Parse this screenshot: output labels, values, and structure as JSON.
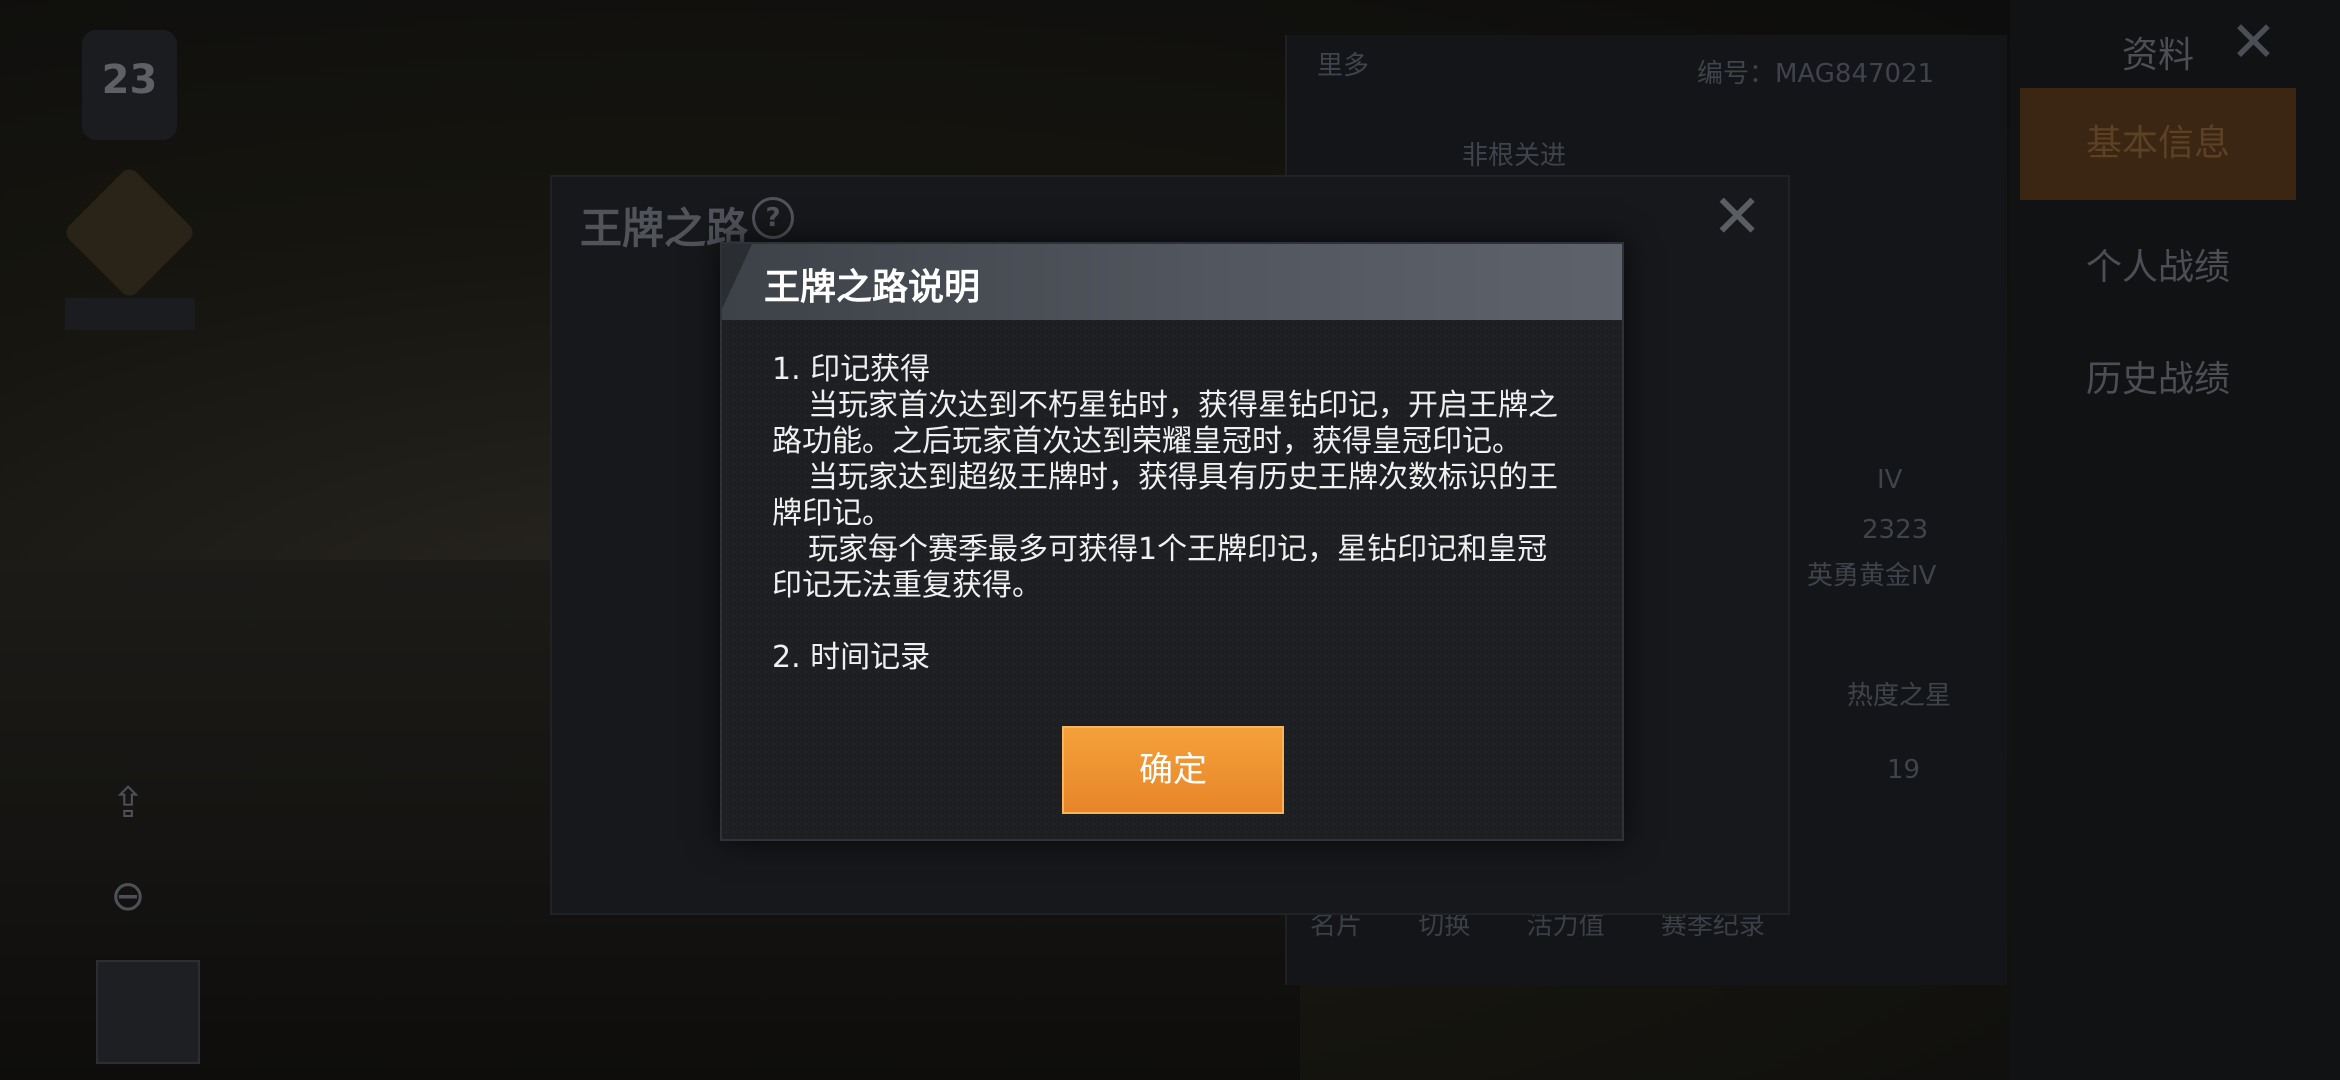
{
  "background": {
    "badge_text": "23",
    "emblem_label": "",
    "profile_rows": [
      "里多",
      "编号：MAG847021",
      "非根关进",
      "IV",
      "2323",
      "英勇黄金IV",
      "热度之星",
      "19"
    ],
    "right_tabs": {
      "active": "基本信息",
      "items": [
        "个人战绩",
        "历史战绩"
      ],
      "header": "资料"
    },
    "bottom_bar": [
      "名片",
      "切换",
      "活力值",
      "赛季纪录"
    ]
  },
  "outer_dialog": {
    "title": "王牌之路",
    "help_glyph": "?",
    "close_glyph": "✕"
  },
  "modal": {
    "title": "王牌之路说明",
    "section1_heading": "1. 印记获得",
    "section1_para1": "当玩家首次达到不朽星钻时，获得星钻印记，开启王牌之路功能。之后玩家首次达到荣耀皇冠时，获得皇冠印记。",
    "section1_para2": "当玩家达到超级王牌时，获得具有历史王牌次数标识的王牌印记。",
    "section1_para3": "玩家每个赛季最多可获得1个王牌印记，星钻印记和皇冠印记无法重复获得。",
    "section2_heading": "2. 时间记录",
    "confirm_label": "确定"
  }
}
